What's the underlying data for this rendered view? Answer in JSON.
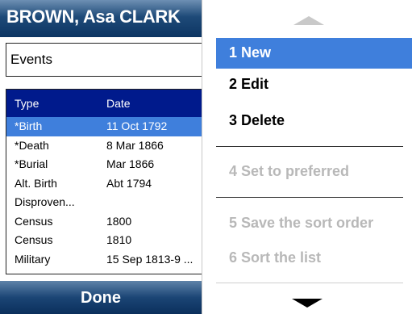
{
  "title": "BROWN, Asa CLARK",
  "view_selector": {
    "value": "Events"
  },
  "grid": {
    "columns": [
      "Type",
      "Date"
    ],
    "rows": [
      {
        "type": "*Birth",
        "date": "11 Oct 1792",
        "selected": true
      },
      {
        "type": "*Death",
        "date": "8 Mar 1866"
      },
      {
        "type": "*Burial",
        "date": "Mar 1866"
      },
      {
        "type": "Alt. Birth",
        "date": "Abt 1794"
      },
      {
        "type": "Disproven...",
        "date": ""
      },
      {
        "type": "Census",
        "date": "1800"
      },
      {
        "type": "Census",
        "date": "1810"
      },
      {
        "type": "Military",
        "date": "15 Sep 1813-9 ..."
      }
    ]
  },
  "softkey": {
    "left_label": "Done"
  },
  "menu": {
    "items": [
      {
        "label": "1 New",
        "state": "highlighted"
      },
      {
        "label": "2 Edit",
        "state": "enabled"
      },
      {
        "label": "3 Delete",
        "state": "enabled"
      },
      {
        "label": "4 Set to preferred",
        "state": "disabled"
      },
      {
        "label": "5 Save the sort order",
        "state": "disabled"
      },
      {
        "label": "6 Sort the list",
        "state": "disabled"
      }
    ]
  },
  "colors": {
    "title_bar": "#1e4a78",
    "grid_header": "#001a8c",
    "selection": "#3f7fdc",
    "disabled_text": "#b8b8b8"
  },
  "icons": {
    "scroll_up": "triangle-up-icon",
    "scroll_down": "triangle-down-icon"
  }
}
